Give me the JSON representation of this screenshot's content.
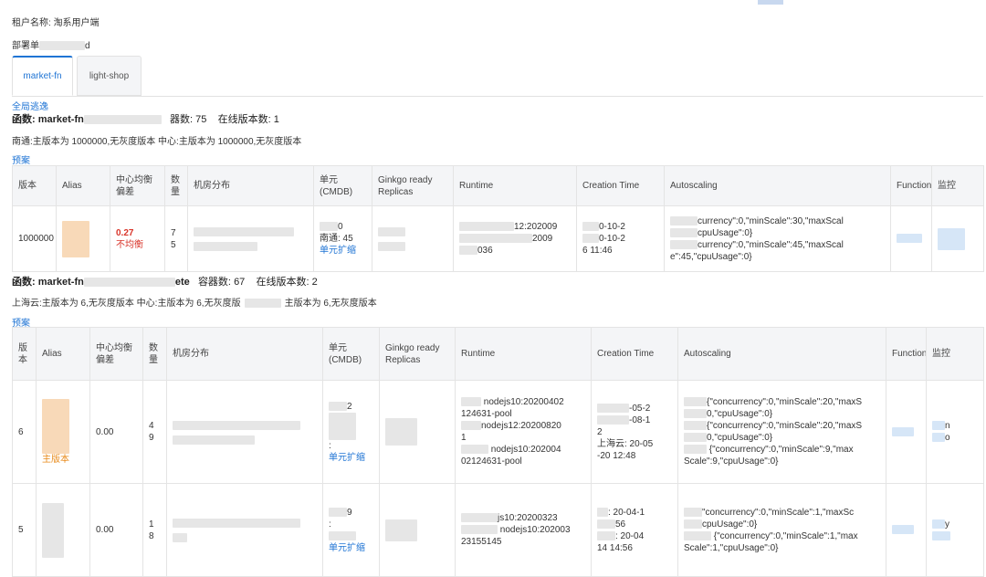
{
  "header": {
    "tenant_label": "租户名称:",
    "tenant_value": "淘系用户端",
    "deploy_label": "部署单",
    "deploy_suffix": "d"
  },
  "tabs": [
    {
      "label": "market-fn",
      "active": true
    },
    {
      "label": "light-shop",
      "active": false
    }
  ],
  "select_all": "全局逃逸",
  "functions": [
    {
      "fn_label": "函数:",
      "fn_name": "market-fn",
      "container_label": "器数:",
      "container_count": "75",
      "online_label": "在线版本数:",
      "online_count": "1",
      "summary": "南通:主版本为 1000000,无灰度版本    中心:主版本为 1000000,无灰度版本",
      "preview": "预案",
      "columns": [
        "版本",
        "Alias",
        "中心均衡偏差",
        "数量",
        "机房分布",
        "单元(CMDB)",
        "Ginkgo ready Replicas",
        "Runtime",
        "Creation Time",
        "Autoscaling",
        "Function",
        "监控"
      ],
      "rows": [
        {
          "version": "1000000",
          "deviation": "0.27",
          "status": "不均衡",
          "count": [
            "7",
            "5"
          ],
          "unit": [
            "0",
            "南通: 45"
          ],
          "unit_link": "单元扩缩",
          "runtime": [
            "12:202009",
            "2009",
            "036"
          ],
          "creation": [
            "0-10-2",
            "0-10-2",
            "6 11:46"
          ],
          "autoscaling": [
            "currency\":0,\"minScale\":30,\"maxScal",
            "cpuUsage\":0}",
            "currency\":0,\"minScale\":45,\"maxScal",
            "e\":45,\"cpuUsage\":0}"
          ]
        }
      ]
    },
    {
      "fn_label": "函数:",
      "fn_name": "market-fn",
      "fn_suffix": "ete",
      "container_label": "容器数:",
      "container_count": "67",
      "online_label": "在线版本数:",
      "online_count": "2",
      "summary_a": "上海云:主版本为 6,无灰度版本    中心:主版本为 6,无灰度版",
      "summary_b": "主版本为 6,无灰度版本",
      "preview": "预案",
      "columns": [
        "版本",
        "Alias",
        "中心均衡偏差",
        "数量",
        "机房分布",
        "单元(CMDB)",
        "Ginkgo ready Replicas",
        "Runtime",
        "Creation Time",
        "Autoscaling",
        "Function",
        "监控"
      ],
      "rows": [
        {
          "version": "6",
          "alias_tail": "主版本",
          "deviation": "0.00",
          "count": [
            "4",
            "9"
          ],
          "unit": [
            "2",
            ":"
          ],
          "unit_link": "单元扩缩",
          "runtime": [
            "nodejs10:20200402",
            "124631-pool",
            "nodejs12:20200820",
            "1",
            "nodejs10:202004",
            "02124631-pool"
          ],
          "creation": [
            "-05-2",
            "-08-1",
            "2",
            "上海云: 20-05",
            "-20 12:48"
          ],
          "autoscaling": [
            "{\"concurrency\":0,\"minScale\":20,\"maxS",
            "0,\"cpuUsage\":0}",
            "{\"concurrency\":0,\"minScale\":20,\"maxS",
            "0,\"cpuUsage\":0}",
            "{\"concurrency\":0,\"minScale\":9,\"max",
            "Scale\":9,\"cpuUsage\":0}"
          ],
          "monitor": [
            "n",
            "o"
          ]
        },
        {
          "version": "5",
          "deviation": "0.00",
          "count": [
            "1",
            "8"
          ],
          "unit": [
            "9",
            ":"
          ],
          "unit_link": "单元扩缩",
          "runtime": [
            "js10:20200323",
            "nodejs10:202003",
            "23155145"
          ],
          "creation": [
            ": 20-04-1",
            "56",
            ": 20-04",
            "14 14:56"
          ],
          "autoscaling": [
            "\"concurrency\":0,\"minScale\":1,\"maxSc",
            "cpuUsage\":0}",
            "{\"concurrency\":0,\"minScale\":1,\"max",
            "Scale\":1,\"cpuUsage\":0}"
          ],
          "monitor": [
            "y"
          ]
        }
      ]
    }
  ],
  "colors": {
    "link": "#1f74d4",
    "warn": "#d9362b",
    "header_bg": "#f4f5f7",
    "border": "#e4e4e4"
  }
}
